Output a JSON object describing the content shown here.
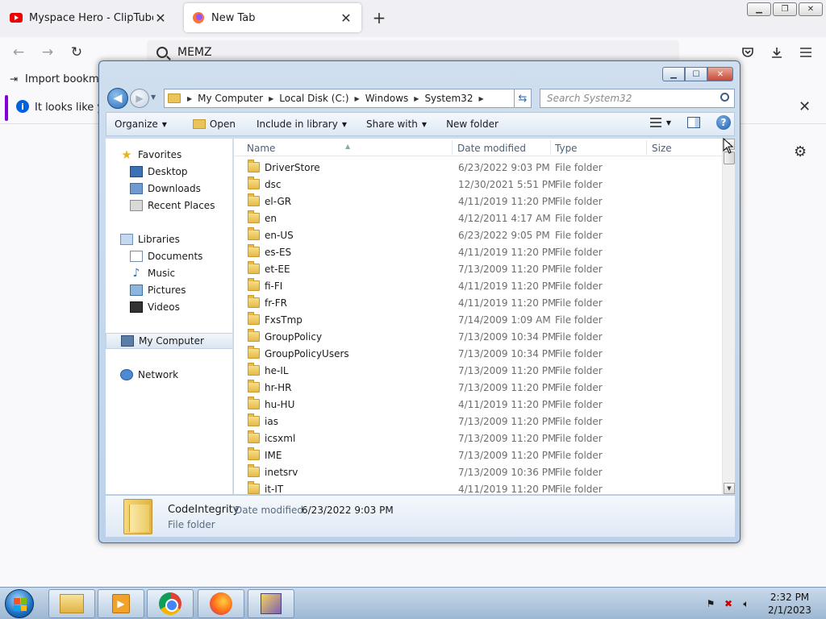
{
  "browser": {
    "tabs": [
      {
        "title": "Myspace Hero - ClipTube",
        "active": false,
        "favicon": "youtube-icon"
      },
      {
        "title": "New Tab",
        "active": true,
        "favicon": "firefox-icon"
      }
    ],
    "url_text": "MEMZ",
    "bookmark_item": "Import bookmark",
    "notice_text": "It looks like yo"
  },
  "explorer": {
    "breadcrumb": [
      "My Computer",
      "Local Disk (C:)",
      "Windows",
      "System32"
    ],
    "search_placeholder": "Search System32",
    "toolbar": {
      "organize": "Organize",
      "open": "Open",
      "include_in_library": "Include in library",
      "share_with": "Share with",
      "new_folder": "New folder"
    },
    "nav_pane": {
      "favorites": "Favorites",
      "favorite_items": [
        "Desktop",
        "Downloads",
        "Recent Places"
      ],
      "libraries": "Libraries",
      "library_items": [
        "Documents",
        "Music",
        "Pictures",
        "Videos"
      ],
      "computer": "My Computer",
      "network": "Network"
    },
    "columns": {
      "name": "Name",
      "date_modified": "Date modified",
      "type": "Type",
      "size": "Size"
    },
    "files": [
      {
        "name": "DriverStore",
        "date": "6/23/2022 9:03 PM",
        "type": "File folder"
      },
      {
        "name": "dsc",
        "date": "12/30/2021 5:51 PM",
        "type": "File folder"
      },
      {
        "name": "el-GR",
        "date": "4/11/2019 11:20 PM",
        "type": "File folder"
      },
      {
        "name": "en",
        "date": "4/12/2011 4:17 AM",
        "type": "File folder"
      },
      {
        "name": "en-US",
        "date": "6/23/2022 9:05 PM",
        "type": "File folder"
      },
      {
        "name": "es-ES",
        "date": "4/11/2019 11:20 PM",
        "type": "File folder"
      },
      {
        "name": "et-EE",
        "date": "7/13/2009 11:20 PM",
        "type": "File folder"
      },
      {
        "name": "fi-FI",
        "date": "4/11/2019 11:20 PM",
        "type": "File folder"
      },
      {
        "name": "fr-FR",
        "date": "4/11/2019 11:20 PM",
        "type": "File folder"
      },
      {
        "name": "FxsTmp",
        "date": "7/14/2009 1:09 AM",
        "type": "File folder"
      },
      {
        "name": "GroupPolicy",
        "date": "7/13/2009 10:34 PM",
        "type": "File folder"
      },
      {
        "name": "GroupPolicyUsers",
        "date": "7/13/2009 10:34 PM",
        "type": "File folder"
      },
      {
        "name": "he-IL",
        "date": "7/13/2009 11:20 PM",
        "type": "File folder"
      },
      {
        "name": "hr-HR",
        "date": "7/13/2009 11:20 PM",
        "type": "File folder"
      },
      {
        "name": "hu-HU",
        "date": "4/11/2019 11:20 PM",
        "type": "File folder"
      },
      {
        "name": "ias",
        "date": "7/13/2009 11:20 PM",
        "type": "File folder"
      },
      {
        "name": "icsxml",
        "date": "7/13/2009 11:20 PM",
        "type": "File folder"
      },
      {
        "name": "IME",
        "date": "7/13/2009 11:20 PM",
        "type": "File folder"
      },
      {
        "name": "inetsrv",
        "date": "7/13/2009 10:36 PM",
        "type": "File folder"
      },
      {
        "name": "it-IT",
        "date": "4/11/2019 11:20 PM",
        "type": "File folder"
      }
    ],
    "details": {
      "name": "CodeIntegrity",
      "date_label": "Date modified:",
      "date_value": "6/23/2022 9:03 PM",
      "type": "File folder"
    }
  },
  "taskbar": {
    "apps": [
      "windows-explorer-icon",
      "media-player-icon",
      "chrome-icon",
      "firefox-icon",
      "memz-icon"
    ],
    "time": "2:32 PM",
    "date": "2/1/2023"
  }
}
